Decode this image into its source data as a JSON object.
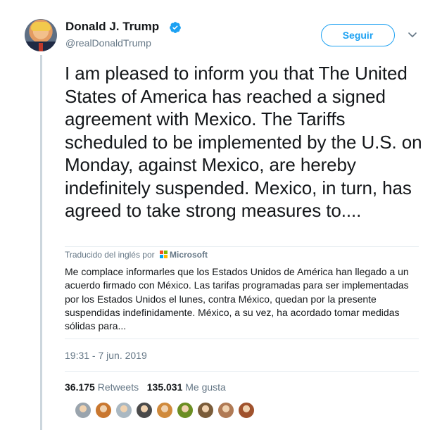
{
  "author": {
    "name": "Donald J. Trump",
    "handle": "@realDonaldTrump",
    "verified": true,
    "avatar_icon": "profile-photo"
  },
  "follow_button": {
    "label": "Seguir",
    "color": "#1da1f2"
  },
  "menu_icon": "chevron-down-icon",
  "tweet": {
    "text": "I am pleased to inform you that The United States of America has reached a signed agreement with Mexico. The Tariffs scheduled to be implemented by the U.S. on Monday, against Mexico, are hereby indefinitely suspended. Mexico, in turn, has agreed to take strong measures to...."
  },
  "translation": {
    "label": "Traducido del inglés por",
    "provider": "Microsoft",
    "text": "Me complace informarles que los Estados Unidos de América han llegado a un acuerdo firmado con México. Las tarifas programadas para ser implementadas por los Estados Unidos el lunes, contra México, quedan por la presente suspendidas indefinidamente. México, a su vez, ha acordado tomar medidas sólidas para..."
  },
  "timestamp": "19:31 - 7 jun. 2019",
  "stats": {
    "retweets_count": "36.175",
    "retweets_label": "Retweets",
    "likes_count": "135.031",
    "likes_label": "Me gusta"
  },
  "likers": [
    {
      "color": "#9aa4ad"
    },
    {
      "color": "#c9772f"
    },
    {
      "color": "#aab8c2"
    },
    {
      "color": "#4a4a4a"
    },
    {
      "color": "#d08a3c"
    },
    {
      "color": "#6b8e23"
    },
    {
      "color": "#7a5c3a"
    },
    {
      "color": "#b07a55"
    },
    {
      "color": "#a0522d"
    }
  ]
}
